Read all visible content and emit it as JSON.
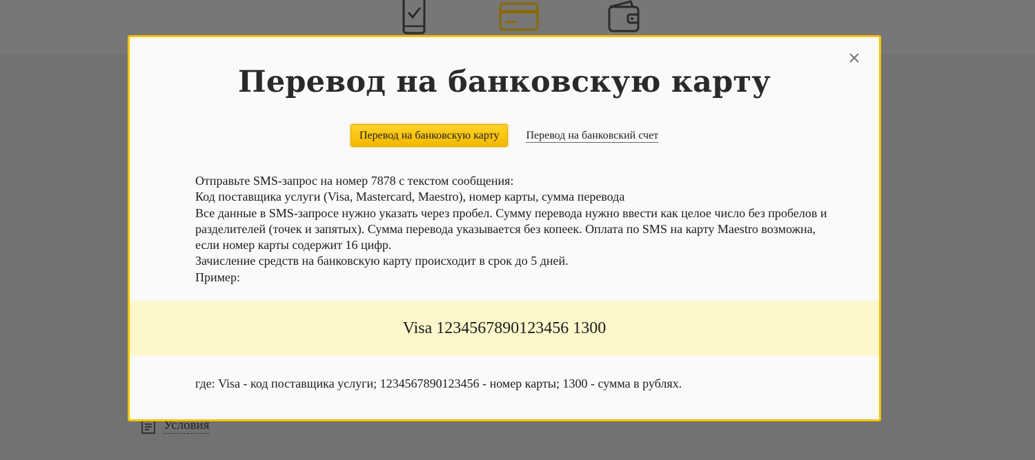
{
  "background": {
    "icons": [
      "phone-check-icon",
      "bank-card-icon",
      "wallet-icon"
    ],
    "conditions_label": "Условия"
  },
  "modal": {
    "title": "Перевод на банковскую карту",
    "tabs": [
      {
        "label": "Перевод на банковскую карту",
        "active": true
      },
      {
        "label": "Перевод на банковский счет",
        "active": false
      }
    ],
    "instructions": [
      "Отправьте SMS-запрос на номер 7878 с текстом сообщения:",
      "Код поставщика услуги (Visa, Mastercard, Maestro), номер карты, сумма перевода",
      "Все данные в SMS-запросе нужно указать через пробел. Сумму перевода нужно ввести как целое число без пробелов и разделителей (точек и запятых). Сумма перевода указывается без копеек. Оплата по SMS на карту Maestro возможна, если номер карты содержит 16 цифр.",
      "Зачисление средств на банковскую карту происходит в срок  до 5 дней.",
      "Пример:"
    ],
    "example": "Visa 1234567890123456 1300",
    "footnote": "где: Visa - код поставщика услуги; 1234567890123456 - номер карты; 1300 - сумма в рублях."
  },
  "colors": {
    "accent": "#f3c300",
    "example_bg": "#fef7cb",
    "overlay_bg": "#727272"
  }
}
